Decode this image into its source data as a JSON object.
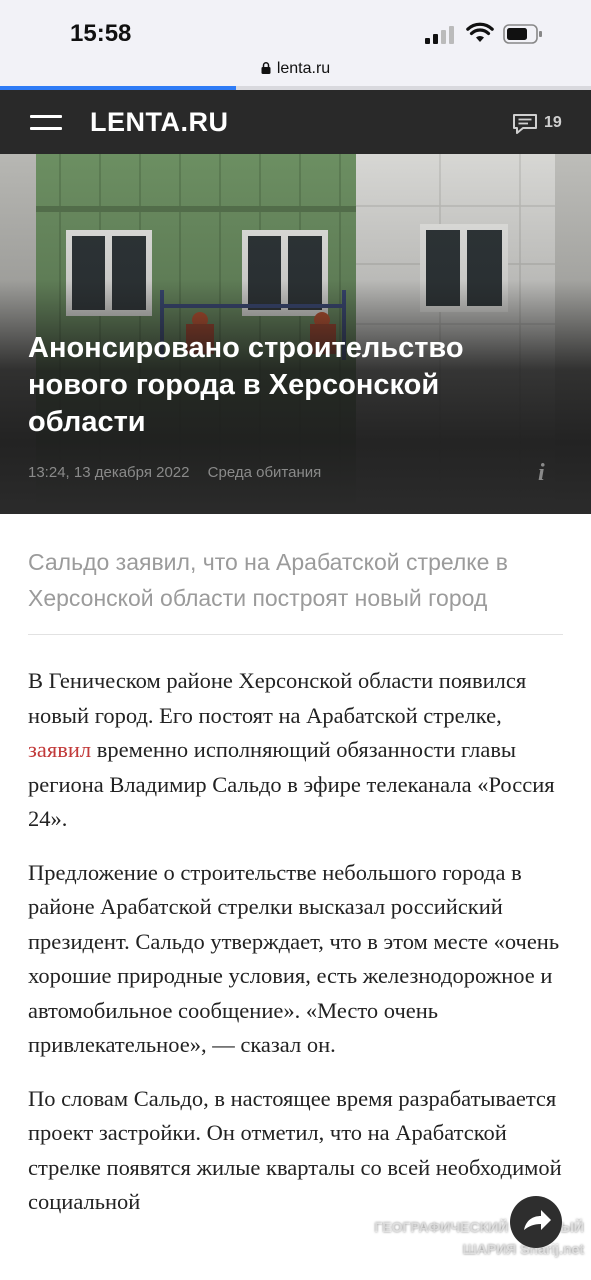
{
  "status_bar": {
    "time": "15:58"
  },
  "browser": {
    "url": "lenta.ru",
    "load_progress": 0.4
  },
  "header": {
    "logo": "LENTA.RU",
    "comments_count": "19"
  },
  "hero": {
    "title": "Анонсировано строительство нового города в Херсонской области",
    "datetime": "13:24, 13 декабря 2022",
    "rubric": "Среда обитания",
    "info_icon": "i"
  },
  "article": {
    "lead": "Сальдо заявил, что на Арабатской стрелке в Херсонской области построят новый город",
    "p1_before_link": "В Геническом районе Херсонской области появился новый город. Его постоят на Арабатской стрелке, ",
    "p1_link": "заявил",
    "p1_after_link": " временно исполняющий обязанности главы региона Владимир Сальдо в эфире телеканала «Россия 24».",
    "p2": "Предложение о строительстве небольшого города в районе Арабатской стрелки высказал российский президент. Сальдо утверждает, что в этом месте «очень хорошие природные условия, есть железнодорожное и автомобильное сообщение». «Место очень привлекательное», — сказал он.",
    "p3": "По словам Сальдо, в настоящее время разрабатывается проект застройки. Он отметил, что на Арабатской стрелке появятся жилые кварталы со всей необходимой социальной"
  },
  "watermark": {
    "line1": "ГЕОГРАФИЧЕСКИЙ ЧАСТНЫЙ",
    "line2": "ШАРИЯ Sharij.net"
  },
  "colors": {
    "header_bg": "#292929",
    "link": "#c23a3a",
    "lead": "#9b9b9b",
    "progress": "#2f7cf6"
  },
  "icons": [
    "menu-icon",
    "comments-icon",
    "info-icon",
    "lock-icon",
    "signal-icon",
    "wifi-icon",
    "battery-icon",
    "share-arrow-icon"
  ]
}
